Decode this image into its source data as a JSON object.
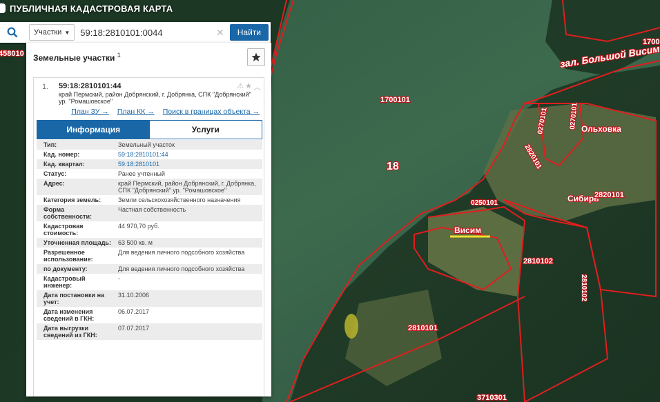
{
  "app": {
    "title": "ПУБЛИЧНАЯ КАДАСТРОВАЯ КАРТА"
  },
  "search": {
    "type_label": "Участки",
    "query": "59:18:2810101:0044",
    "button_label": "Найти"
  },
  "panel": {
    "title": "Земельные участки",
    "count": "1",
    "object": {
      "number": "1.",
      "cad_number": "59:18:2810101:44",
      "address": "край Пермский, район Добрянский, г. Добрянка, СПК \"Добрянский\" ур. \"Ромашовское\""
    },
    "links": [
      "План ЗУ →",
      "План КК →",
      "Поиск в границах объекта →"
    ],
    "tabs": [
      {
        "label": "Информация",
        "active": true
      },
      {
        "label": "Услуги",
        "active": false
      }
    ],
    "properties": [
      {
        "key": "Тип:",
        "value": "Земельный участок"
      },
      {
        "key": "Кад. номер:",
        "value": "59:18:2810101:44",
        "link": true
      },
      {
        "key": "Кад. квартал:",
        "value": "59:18:2810101",
        "link": true
      },
      {
        "key": "Статус:",
        "value": "Ранее учтенный"
      },
      {
        "key": "Адрес:",
        "value": "край Пермский, район Добрянский, г. Добрянка, СПК \"Добрянский\" ур. \"Ромашовское\""
      },
      {
        "key": "Категория земель:",
        "value": "Земли сельскохозяйственного назначения"
      },
      {
        "key": "Форма собственности:",
        "value": "Частная собственность"
      },
      {
        "key": "Кадастровая стоимость:",
        "value": "44 970,70 руб."
      },
      {
        "key": "Уточненная площадь:",
        "value": "63 500 кв. м"
      },
      {
        "key": "Разрешенное использование:",
        "value": "Для ведения личного подсобного хозяйства"
      },
      {
        "key": "по документу:",
        "value": "Для ведения личного подсобного хозяйства"
      },
      {
        "key": "Кадастровый инженер:",
        "value": "-"
      },
      {
        "key": "Дата постановки на учет:",
        "value": "31.10.2006"
      },
      {
        "key": "Дата изменения сведений в ГКН:",
        "value": "06.07.2017"
      },
      {
        "key": "Дата выгрузки сведений из ГКН:",
        "value": "07.07.2017"
      }
    ]
  },
  "map": {
    "labels": [
      {
        "id": "edge-left",
        "text": "458010"
      },
      {
        "id": "edge-right",
        "text": "1700"
      },
      {
        "id": "bay",
        "text": "зал. Большой Висим"
      },
      {
        "id": "q1700101",
        "text": "1700101"
      },
      {
        "id": "big18",
        "text": "18"
      },
      {
        "id": "q0270101",
        "text": "0270101"
      },
      {
        "id": "q0270101b",
        "text": "0270101"
      },
      {
        "id": "olkhovka",
        "text": "Ольховка"
      },
      {
        "id": "q2820101a",
        "text": "2820101"
      },
      {
        "id": "sibir",
        "text": "Сибирь"
      },
      {
        "id": "q2820101b",
        "text": "2820101"
      },
      {
        "id": "q0250101",
        "text": "0250101"
      },
      {
        "id": "visim",
        "text": "Висим"
      },
      {
        "id": "q2810102a",
        "text": "2810102"
      },
      {
        "id": "q2810102b",
        "text": "2810102"
      },
      {
        "id": "q2810101",
        "text": "2810101"
      },
      {
        "id": "q3710301",
        "text": "3710301"
      }
    ]
  }
}
